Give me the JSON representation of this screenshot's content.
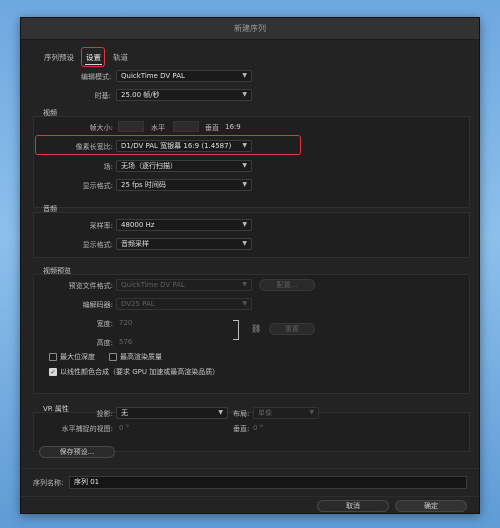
{
  "dialog": {
    "title": "新建序列"
  },
  "tabs": [
    {
      "label": "序列预设"
    },
    {
      "label": "设置"
    },
    {
      "label": "轨道"
    }
  ],
  "general": {
    "editing_mode_label": "编辑模式:",
    "editing_mode_value": "QuickTime DV PAL",
    "timebase_label": "时基:",
    "timebase_value": "25.00  帧/秒"
  },
  "video": {
    "title": "视频",
    "frame_size_label": "帧大小:",
    "horizontal_label": "水平",
    "vertical_label": "垂直",
    "aspect": "16:9",
    "pixel_aspect_label": "像素长宽比:",
    "pixel_aspect_value": "D1/DV PAL 宽银幕 16:9 (1.4587)",
    "fields_label": "场:",
    "fields_value": "无场（逐行扫描）",
    "display_format_label": "显示格式:",
    "display_format_value": "25 fps 时间码"
  },
  "audio": {
    "title": "音频",
    "sample_rate_label": "采样率:",
    "sample_rate_value": "48000 Hz",
    "display_format_label": "显示格式:",
    "display_format_value": "音频采样"
  },
  "preview": {
    "title": "视频预览",
    "file_format_label": "预览文件格式:",
    "file_format_value": "QuickTime DV PAL",
    "configure_label": "配置...",
    "codec_label": "编解码器:",
    "codec_value": "DV25 PAL",
    "width_label": "宽度:",
    "width_value": "720",
    "height_label": "高度:",
    "height_value": "576",
    "reset_label": "重置",
    "max_depth_label": "最大位深度",
    "max_quality_label": "最高渲染质量",
    "linear_label": "以线性颜色合成（要求 GPU 加速或最高渲染品质）"
  },
  "vr": {
    "title": "VR 属性",
    "projection_label": "投影:",
    "projection_value": "无",
    "layout_label": "布局:",
    "layout_value": "单像",
    "h_view_label": "水平捕捉的视图:",
    "h_view_value": "0 °",
    "v_label": "垂直:",
    "v_value": "0 °"
  },
  "save_preset_label": "保存预设...",
  "sequence_name_label": "序列名称:",
  "sequence_name_value": "序列 01",
  "cancel_label": "取消",
  "ok_label": "确定"
}
